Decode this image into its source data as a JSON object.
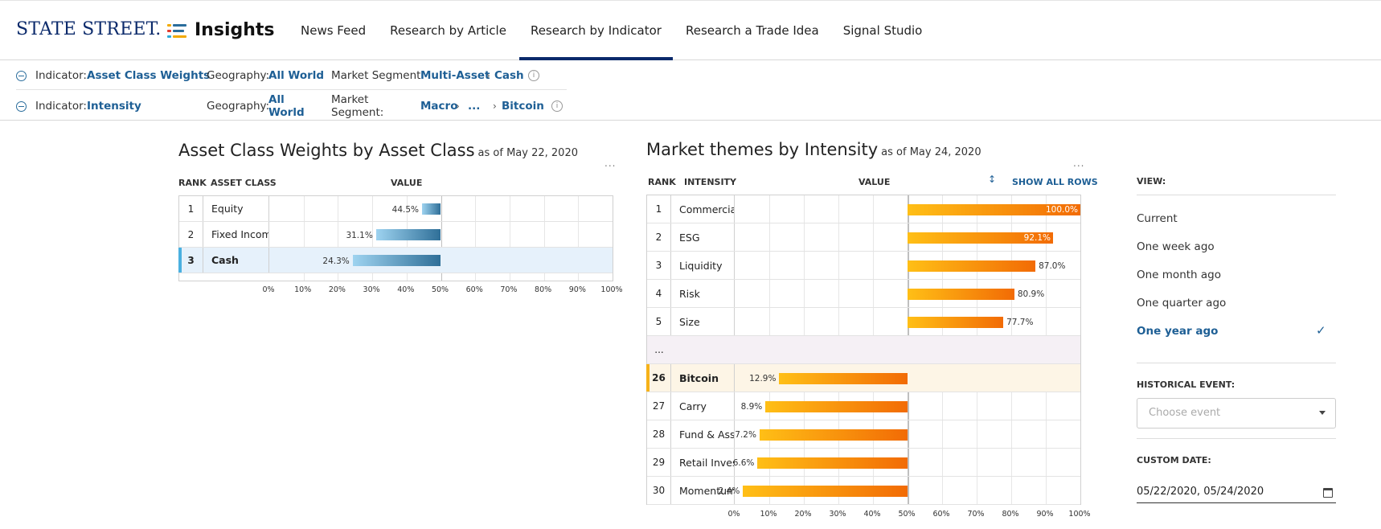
{
  "header": {
    "logo": "STATE STREET.",
    "app_title": "Insights",
    "nav": [
      {
        "label": "News Feed"
      },
      {
        "label": "Research by Article"
      },
      {
        "label": "Research by Indicator",
        "active": true
      },
      {
        "label": "Research a Trade Idea"
      },
      {
        "label": "Signal Studio"
      }
    ]
  },
  "filters": [
    {
      "indicator_label": "Indicator:",
      "indicator": "Asset Class Weights",
      "geography_label": "Geography:",
      "geography": "All World",
      "segment_label": "Market Segment:",
      "segment_path": [
        "Multi-Asset",
        "Cash"
      ]
    },
    {
      "indicator_label": "Indicator:",
      "indicator": "Intensity",
      "geography_label": "Geography:",
      "geography": "All World",
      "segment_label": "Market Segment:",
      "segment_path": [
        "Macro",
        "...",
        "Bitcoin"
      ]
    }
  ],
  "colors": {
    "navy": "#0b2a6b",
    "link": "#1e5f95",
    "blue_bar_light": "#9ed3f0",
    "blue_bar_dark": "#2f6f98",
    "orange_light": "#ffbf16",
    "orange_dark": "#f26b05"
  },
  "left_panel": {
    "title": "Asset Class Weights by Asset Class",
    "as_of": "as of May 22, 2020",
    "col_rank": "RANK",
    "col_name": "ASSET CLASS",
    "col_value": "VALUE"
  },
  "right_panel": {
    "title": "Market themes by Intensity",
    "as_of": "as of May 24, 2020",
    "col_rank": "RANK",
    "col_name": "INTENSITY",
    "col_value": "VALUE",
    "show_all": "SHOW ALL ROWS",
    "separator": "..."
  },
  "chart_data": [
    {
      "type": "bar",
      "title": "Asset Class Weights by Asset Class",
      "baseline": 50,
      "xlim": [
        0,
        100
      ],
      "ticks": [
        "0%",
        "10%",
        "20%",
        "30%",
        "40%",
        "50%",
        "60%",
        "70%",
        "80%",
        "90%",
        "100%"
      ],
      "rows": [
        {
          "rank": "1",
          "name": "Equity",
          "value": 44.5,
          "label": "44.5%"
        },
        {
          "rank": "2",
          "name": "Fixed Income",
          "value": 31.1,
          "label": "31.1%"
        },
        {
          "rank": "3",
          "name": "Cash",
          "value": 24.3,
          "label": "24.3%",
          "selected": true
        }
      ]
    },
    {
      "type": "bar",
      "title": "Market themes by Intensity",
      "baseline": 50,
      "xlim": [
        0,
        100
      ],
      "ticks": [
        "0%",
        "10%",
        "20%",
        "30%",
        "40%",
        "50%",
        "60%",
        "70%",
        "80%",
        "90%",
        "100%"
      ],
      "rows_top": [
        {
          "rank": "1",
          "name": "Commercial ...",
          "value": 100.0,
          "label": "100.0%"
        },
        {
          "rank": "2",
          "name": "ESG",
          "value": 92.1,
          "label": "92.1%"
        },
        {
          "rank": "3",
          "name": "Liquidity",
          "value": 87.0,
          "label": "87.0%"
        },
        {
          "rank": "4",
          "name": "Risk",
          "value": 80.9,
          "label": "80.9%"
        },
        {
          "rank": "5",
          "name": "Size",
          "value": 77.7,
          "label": "77.7%"
        }
      ],
      "rows_bottom": [
        {
          "rank": "26",
          "name": "Bitcoin",
          "value": 12.9,
          "label": "12.9%",
          "selected": true
        },
        {
          "rank": "27",
          "name": "Carry",
          "value": 8.9,
          "label": "8.9%"
        },
        {
          "rank": "28",
          "name": "Fund & Asse...",
          "value": 7.2,
          "label": "7.2%"
        },
        {
          "rank": "29",
          "name": "Retail Invest...",
          "value": 6.6,
          "label": "6.6%"
        },
        {
          "rank": "30",
          "name": "Momentum",
          "value": 2.4,
          "label": "2.4%"
        }
      ]
    }
  ],
  "view_panel": {
    "title": "VIEW:",
    "options": [
      {
        "label": "Current"
      },
      {
        "label": "One week ago"
      },
      {
        "label": "One month ago"
      },
      {
        "label": "One quarter ago"
      },
      {
        "label": "One year ago",
        "selected": true
      }
    ],
    "historical_title": "HISTORICAL EVENT:",
    "historical_placeholder": "Choose event",
    "custom_title": "CUSTOM DATE:",
    "custom_value": "05/22/2020, 05/24/2020"
  }
}
